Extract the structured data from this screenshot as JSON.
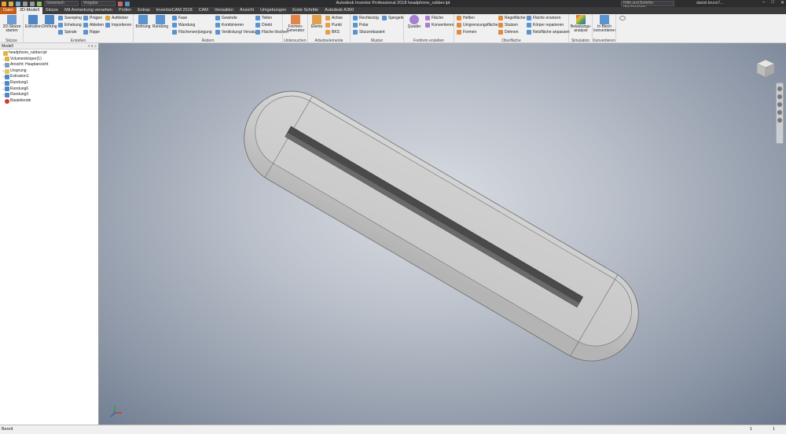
{
  "titlebar": {
    "document_combo": "Generisch",
    "appearance_combo": "Vorgabe",
    "title": "Autodesk Inventor Professional 2018   headphone_rubber.ipt",
    "help_search_placeholder": "Hilfe und Befehle durchsuchen",
    "user": "daniel.bruns7..."
  },
  "tabs": [
    "Datei",
    "3D-Modell",
    "Skizze",
    "Mit Anmerkung versehen",
    "Prüfen",
    "Extras",
    "InventorCAM 2018",
    "CAM",
    "Verwalten",
    "Ansicht",
    "Umgebungen",
    "Erste Schritte",
    "Autodesk A360"
  ],
  "ribbon": {
    "skizze": {
      "title": "Skizze",
      "start_sketch": "2D-Skizze starten"
    },
    "erstellen": {
      "title": "Erstellen",
      "extrusion": "Extrusion",
      "drehung": "Drehung",
      "sweeping": "Sweeping",
      "erhebung": "Erhebung",
      "spirale": "Spirale",
      "prägen": "Prägen",
      "ableiten": "Ableiten",
      "rippe": "Rippe",
      "aufkleber": "Aufkleber",
      "importieren": "Importieren"
    },
    "aendern": {
      "title": "Ändern",
      "bohrung": "Bohrung",
      "rundung": "Rundung",
      "fase": "Fase",
      "wandung": "Wandung",
      "flaechenverjuengung": "Flächenverjüngung",
      "gewinde": "Gewinde",
      "kombinieren": "Kombinieren",
      "verdickung": "Verdickung/ Versatz",
      "teilen": "Teilen",
      "direkt": "Direkt",
      "flaeche_loeschen": "Fläche löschen"
    },
    "untersuchen": {
      "title": "Untersuchen",
      "formen_generator": "Formen-Generator"
    },
    "arbeitselemente": {
      "title": "Arbeitselemente",
      "ebene": "Ebene",
      "achse": "Achse",
      "punkt": "Punkt",
      "bks": "BKS"
    },
    "muster": {
      "title": "Muster",
      "rechteckig": "Rechteckig",
      "polar": "Polar",
      "skizzenbasiert": "Skizzenbasiert",
      "spiegeln": "Spiegeln"
    },
    "freiform": {
      "title": "Freiform erstellen",
      "quader": "Quader",
      "flaeche": "Fläche",
      "konvertieren": "Konvertieren"
    },
    "oberflaeche": {
      "title": "Oberfläche",
      "heften": "Heften",
      "umgrenzungsflaeche": "Umgrenzungsfläche",
      "formen": "Formen",
      "regelflaeche": "Regelfläche",
      "stutzen": "Stutzen",
      "dehnen": "Dehnen",
      "flaeche_ersetzen": "Fläche ersetzen",
      "koerper_reparieren": "Körper reparieren",
      "netzflaeche": "Netzfläche anpassen"
    },
    "simulation": {
      "title": "Simulation",
      "belastungsanalyse": "Belastungs-analyse"
    },
    "konvertieren": {
      "title": "Konvertieren",
      "in_blech": "In Blech konvertieren"
    }
  },
  "browser": {
    "header": "Modell",
    "nodes": [
      {
        "label": "headphone_rubber.ipt",
        "icon": "part-icon",
        "expander": ""
      },
      {
        "label": "Volumenkörper(1)",
        "icon": "solid-bodies-icon",
        "expander": "+"
      },
      {
        "label": "Ansicht: Hauptansicht",
        "icon": "view-icon",
        "expander": "+"
      },
      {
        "label": "Ursprung",
        "icon": "origin-folder-icon",
        "expander": "+"
      },
      {
        "label": "Extrusion1",
        "icon": "extrusion-icon",
        "expander": "+"
      },
      {
        "label": "Rundung1",
        "icon": "fillet-icon",
        "expander": "+"
      },
      {
        "label": "Rundung6",
        "icon": "fillet-icon",
        "expander": "+"
      },
      {
        "label": "Rundung3",
        "icon": "fillet-icon",
        "expander": "+"
      },
      {
        "label": "Bauteilende",
        "icon": "end-of-part-icon",
        "expander": ""
      }
    ]
  },
  "status": {
    "text": "Bereit",
    "count1": "1",
    "count2": "1"
  },
  "colors": {
    "file_tab": "#c75b12",
    "viewport_center": "#dadde3",
    "viewport_edge": "#6d7a8e",
    "model": "#c9c9c9"
  }
}
